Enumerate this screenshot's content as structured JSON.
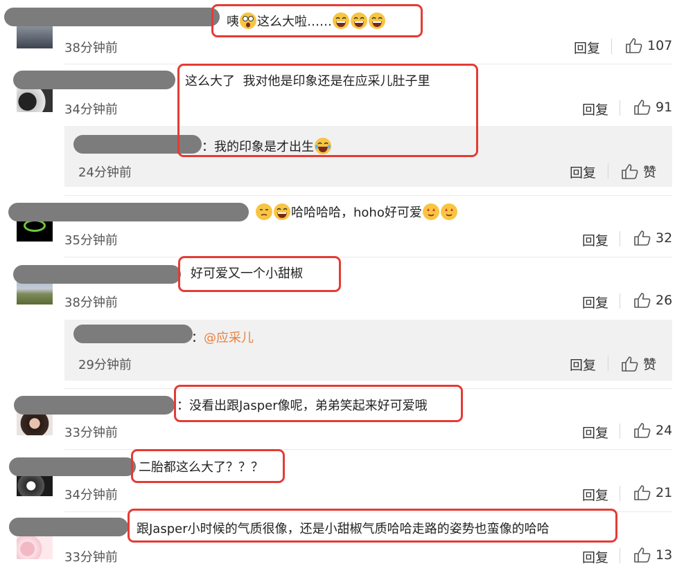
{
  "labels": {
    "reply": "回复",
    "like": "赞"
  },
  "comments": [
    {
      "text": "咦😲这么大啦……😂😂😂",
      "time": "38分钟前",
      "likes": "107"
    },
    {
      "text": "这么大了  我对他是印象还是在应采儿肚子里",
      "time": "34分钟前",
      "likes": "91"
    },
    {
      "text": "哈哈哈哈，hoho好可爱😍😍",
      "time": "35分钟前",
      "likes": "32"
    },
    {
      "text": "好可爱又一个小甜椒",
      "time": "38分钟前",
      "likes": "26"
    },
    {
      "text": "没看出跟Jasper像呢，弟弟笑起来好可爱哦",
      "time": "33分钟前",
      "likes": "24"
    },
    {
      "text": "二胎都这么大了？？？",
      "time": "34分钟前",
      "likes": "21"
    },
    {
      "text": "跟Jasper小时候的气质很像，还是小甜椒气质哈哈走路的姿势也蛮像的哈哈",
      "time": "33分钟前",
      "likes": "13"
    }
  ],
  "replies": [
    {
      "text": "我的印象是才出生😂",
      "time": "24分钟前"
    },
    {
      "mention": "@应采儿",
      "time": "29分钟前"
    }
  ],
  "colors": {
    "highlight": "#e43b35",
    "mention": "#e8813d",
    "reply_bg": "#f1f1f1"
  }
}
